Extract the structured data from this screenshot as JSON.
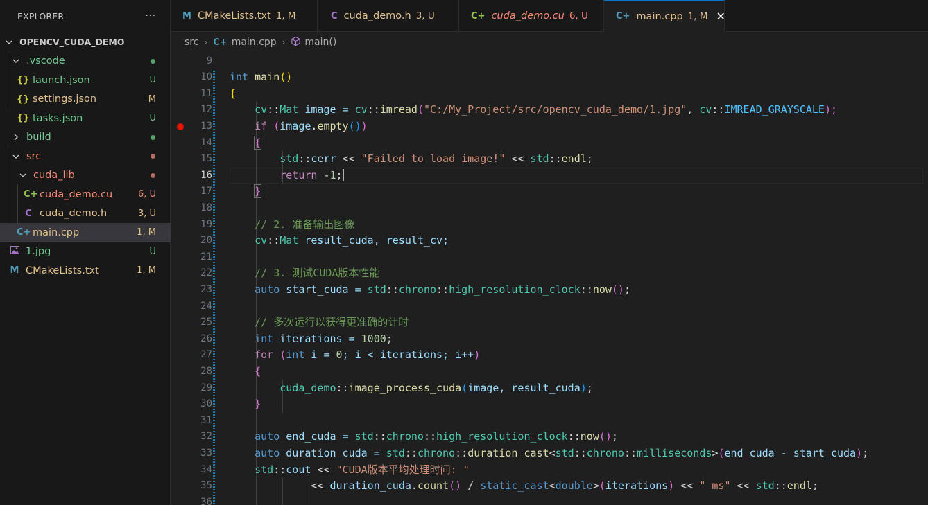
{
  "sidebar": {
    "title": "EXPLORER",
    "more": "···",
    "root": "OPENCV_CUDA_DEMO",
    "items": [
      {
        "label": "launch.json",
        "icon": "{}",
        "badge": "U"
      },
      {
        "label": "settings.json",
        "icon": "{}",
        "badge": "M"
      },
      {
        "label": "tasks.json",
        "icon": "{}",
        "badge": "U"
      },
      {
        "label": "build"
      },
      {
        "label": "src"
      },
      {
        "label": "cuda_lib"
      },
      {
        "label": "cuda_demo.cu",
        "icon": "C+",
        "badge": "6, U"
      },
      {
        "label": "cuda_demo.h",
        "icon": "C",
        "badge": "3, U"
      },
      {
        "label": "main.cpp",
        "icon": "C+",
        "badge": "1, M"
      },
      {
        "label": "1.jpg",
        "badge": "U"
      },
      {
        "label": "CMakeLists.txt",
        "icon": "M",
        "badge": "1, M"
      },
      {
        "label": ".vscode"
      }
    ]
  },
  "tabs": [
    {
      "label": "CMakeLists.txt",
      "icon": "M",
      "badge": "1, M"
    },
    {
      "label": "cuda_demo.h",
      "icon": "C",
      "badge": "3, U"
    },
    {
      "label": "cuda_demo.cu",
      "icon": "C+",
      "badge": "6, U"
    },
    {
      "label": "main.cpp",
      "icon": "C+",
      "badge": "1, M",
      "close": "✕"
    }
  ],
  "breadcrumb": {
    "folder": "src",
    "file": "main.cpp",
    "symbol": "main()"
  },
  "editor": {
    "line_numbers": [
      "9",
      "10",
      "11",
      "12",
      "13",
      "14",
      "15",
      "16",
      "17",
      "18",
      "19",
      "20",
      "21",
      "22",
      "23",
      "24",
      "25",
      "26",
      "27",
      "28",
      "29",
      "30",
      "31",
      "32",
      "33",
      "34",
      "35",
      "36"
    ],
    "l10": {
      "a": "int",
      "b": "main",
      "c": "(",
      "d": ")"
    },
    "l11": {
      "a": "{"
    },
    "l12": {
      "a": "cv",
      "b": "::",
      "c": "Mat",
      "d": " image = ",
      "e": "cv",
      "f": "::",
      "g": "imread",
      "h": "(",
      "i": "\"C:/My_Project/src/opencv_cuda_demo/1.jpg\"",
      "j": ", ",
      "k": "cv",
      "l": "::",
      "m": "IMREAD_GRAYSCALE",
      "n": ");"
    },
    "l13": {
      "a": "if",
      "b": " (",
      "c": "image",
      "d": ".",
      "e": "empty",
      "f": "()",
      "g": ")"
    },
    "l14": {
      "a": "{"
    },
    "l15": {
      "a": "std",
      "b": "::",
      "c": "cerr",
      "d": " << ",
      "e": "\"Failed to load image!\"",
      "f": " << ",
      "g": "std",
      "h": "::",
      "i": "endl",
      "j": ";"
    },
    "l16": {
      "a": "return",
      "b": " -",
      "c": "1",
      "d": ";"
    },
    "l17": {
      "a": "}"
    },
    "l19": {
      "a": "// 2. 准备输出图像"
    },
    "l20": {
      "a": "cv",
      "b": "::",
      "c": "Mat",
      "d": " result_cuda, result_cv;"
    },
    "l22": {
      "a": "// 3. 测试CUDA版本性能"
    },
    "l23": {
      "a": "auto",
      "b": " start_cuda = ",
      "c": "std",
      "d": "::",
      "e": "chrono",
      "f": "::",
      "g": "high_resolution_clock",
      "h": "::",
      "i": "now",
      "j": "()",
      "k": ";"
    },
    "l25": {
      "a": "// 多次运行以获得更准确的计时"
    },
    "l26": {
      "a": "int",
      "b": " iterations = ",
      "c": "1000",
      "d": ";"
    },
    "l27": {
      "a": "for",
      "b": " (",
      "c": "int",
      "d": " i = ",
      "e": "0",
      "f": "; i < iterations; i++",
      "g": ")"
    },
    "l28": {
      "a": "{"
    },
    "l29": {
      "a": "cuda_demo",
      "b": "::",
      "c": "image_process_cuda",
      "d": "(",
      "e": "image, result_cuda",
      "f": ")",
      "g": ";"
    },
    "l30": {
      "a": "}"
    },
    "l32": {
      "a": "auto",
      "b": " end_cuda = ",
      "c": "std",
      "d": "::",
      "e": "chrono",
      "f": "::",
      "g": "high_resolution_clock",
      "h": "::",
      "i": "now",
      "j": "()",
      "k": ";"
    },
    "l33": {
      "a": "auto",
      "b": " duration_cuda = ",
      "c": "std",
      "d": "::",
      "e": "chrono",
      "f": "::",
      "g": "duration_cast",
      "h": "<",
      "i": "std",
      "j": "::",
      "k": "chrono",
      "l": "::",
      "m": "milliseconds",
      "n": ">",
      "o": "(",
      "p": "end_cuda - start_cuda",
      "q": ")",
      "r": ";"
    },
    "l34": {
      "a": "std",
      "b": "::",
      "c": "cout",
      "d": " << ",
      "e": "\"CUDA版本平均处理时间: \""
    },
    "l35": {
      "a": "<< ",
      "b": "duration_cuda",
      "c": ".",
      "d": "count",
      "e": "()",
      "f": " / ",
      "g": "static_cast",
      "h": "<",
      "i": "double",
      "j": ">",
      "k": "(",
      "l": "iterations",
      "m": ")",
      "n": " << ",
      "o": "\" ms\"",
      "p": " << ",
      "q": "std",
      "r": "::",
      "s": "endl",
      "t": ";"
    }
  },
  "colors": {
    "accent": "#0078d4",
    "modified": "#e2c08d",
    "untracked": "#73c991",
    "error": "#f48771",
    "breakpoint": "#e51400"
  }
}
